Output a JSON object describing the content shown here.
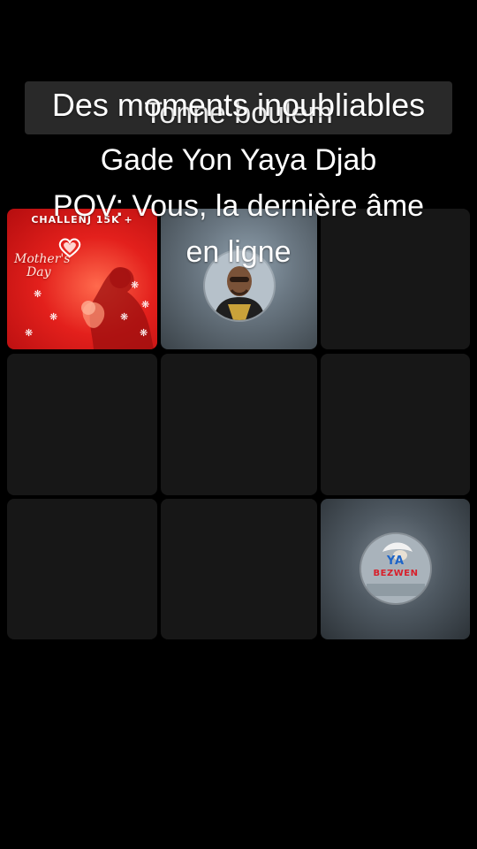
{
  "captions": {
    "line1": "Des moments inoubliables",
    "line1_overlap": "Tonne boulem",
    "line2": "Gade Yon Yaya Djab",
    "line3": "POV: Vous, la dernière âme",
    "line4": "en ligne"
  },
  "grid": {
    "tile1": {
      "badge": "CHALLENJ 15K +",
      "title_line1": "Mother's",
      "title_line2": "Day"
    },
    "tile9": {
      "logo_line1": "YA",
      "logo_line2": "BEZWEN"
    }
  },
  "colors": {
    "background": "#000000",
    "empty_tile": "#171717",
    "caption_bar": "#2c2c2c",
    "poster_red": "#e3201c"
  }
}
